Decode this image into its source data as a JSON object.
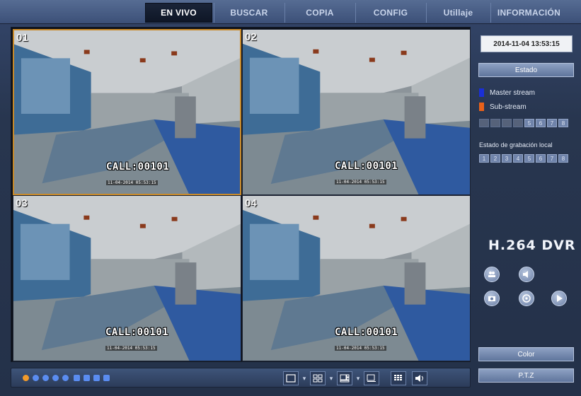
{
  "nav": {
    "items": [
      {
        "label": "EN VIVO",
        "active": true
      },
      {
        "label": "BUSCAR",
        "active": false
      },
      {
        "label": "COPIA",
        "active": false
      },
      {
        "label": "CONFIG",
        "active": false
      },
      {
        "label": "Utillaje",
        "active": false
      },
      {
        "label": "INFORMACIÓN",
        "active": false
      }
    ]
  },
  "cameras": [
    {
      "number": "01",
      "overlay": "CALL:00101",
      "timestamp": "11-04-2014 05:53:15",
      "selected": true
    },
    {
      "number": "02",
      "overlay": "CALL:00101",
      "timestamp": "11-04-2014 05:53:15",
      "selected": false
    },
    {
      "number": "03",
      "overlay": "CALL:00101",
      "timestamp": "11-04-2014 05:53:15",
      "selected": false
    },
    {
      "number": "04",
      "overlay": "CALL:00101",
      "timestamp": "11-04-2014 05:53:15",
      "selected": false
    }
  ],
  "side": {
    "datetime": "2014-11-04 13:53:15",
    "estado_button": "Estado",
    "master_stream": "Master stream",
    "sub_stream": "Sub-stream",
    "stream_channels": [
      "",
      "",
      "",
      "",
      "5",
      "6",
      "7",
      "8"
    ],
    "local_recording_label": "Estado de grabación local",
    "recording_channels": [
      "1",
      "2",
      "3",
      "4",
      "5",
      "6",
      "7",
      "8"
    ],
    "brand": "H.264  DVR",
    "color_button": "Color",
    "ptz_button": "P.T.Z"
  },
  "colors": {
    "master_stream": "#1a2fd6",
    "sub_stream": "#e8611a",
    "active_tab": "#0e1626",
    "selected_border": "#c88a2a"
  },
  "toolbar": {
    "icons": [
      "power-icon",
      "record-icon",
      "record-icon",
      "record-icon",
      "record-icon",
      "user-icon",
      "user-icon",
      "user-icon",
      "user-icon",
      "layout-1-icon",
      "layout-4-icon",
      "layout-8-icon",
      "layout-9-icon",
      "layout-16-icon",
      "volume-icon"
    ]
  }
}
